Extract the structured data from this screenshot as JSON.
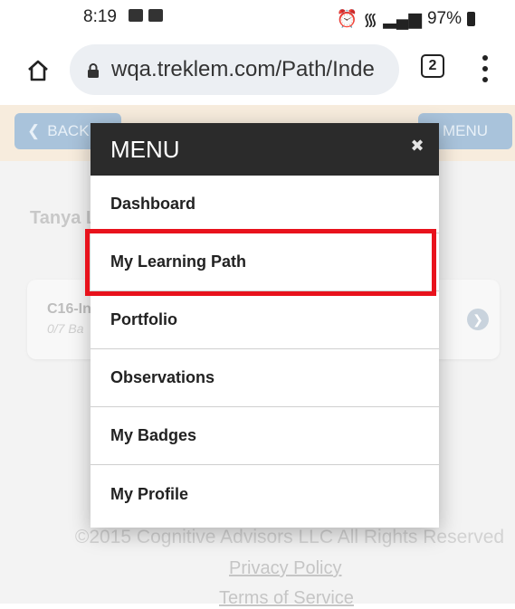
{
  "status_bar": {
    "time": "8:19",
    "battery": "97%",
    "icons_left": [
      "voicemail-icon",
      "image-icon"
    ],
    "icons_right": [
      "alarm-icon",
      "wifi-icon",
      "signal-icon",
      "battery-icon"
    ]
  },
  "browser": {
    "url": "wqa.treklem.com/Path/Inde",
    "tab_count": "2"
  },
  "page": {
    "back_label": "BACK",
    "menu_label": "MENU",
    "user_name": "Tanya L",
    "card_title": "C16-In",
    "card_subtitle": "0/7 Ba",
    "footer_copyright": "©2015 Cognitive Advisors LLC All Rights Reserved",
    "privacy_link": "Privacy Policy",
    "terms_link": "Terms of Service"
  },
  "menu": {
    "title": "MENU",
    "close_icon": "close-icon",
    "items": [
      {
        "label": "Dashboard"
      },
      {
        "label": "My Learning Path"
      },
      {
        "label": "Portfolio"
      },
      {
        "label": "Observations"
      },
      {
        "label": "My Badges"
      },
      {
        "label": "My Profile"
      }
    ]
  },
  "colors": {
    "highlight": "#e8121c",
    "menu_header": "#2b2b2b",
    "nav_button": "#a9c3db"
  }
}
